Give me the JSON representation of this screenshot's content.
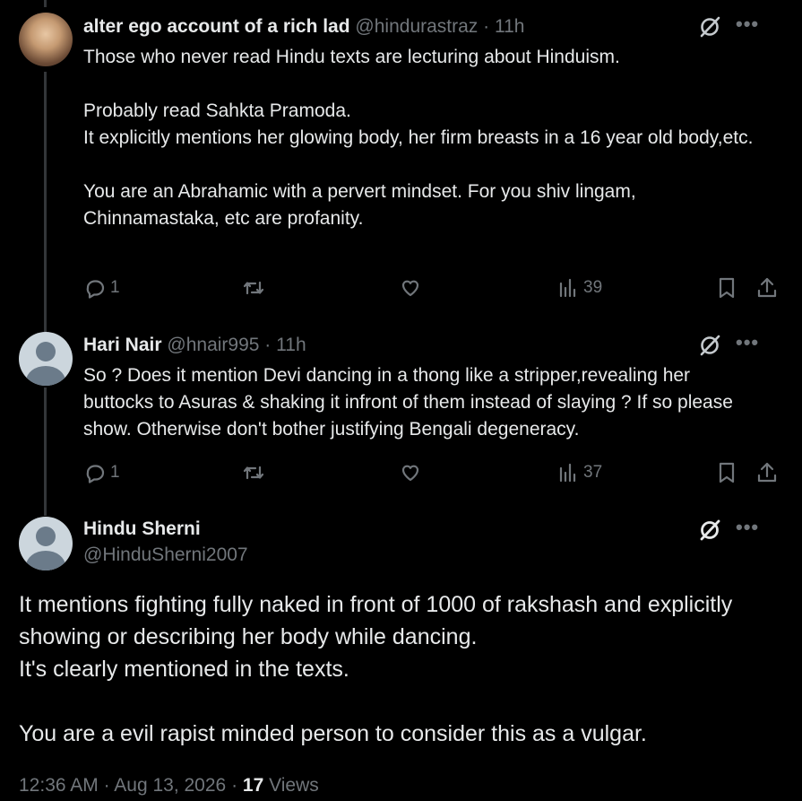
{
  "tweets": [
    {
      "name": "alter ego account of a rich lad",
      "handle": "@hindurastraz",
      "dot": "·",
      "time": "11h",
      "paragraphs": [
        "Those who never read Hindu texts are lecturing about Hinduism.",
        "",
        "Probably read Sahkta Pramoda.",
        "It explicitly mentions her glowing body, her firm breasts in a 16 year old body,etc.",
        "",
        "You are an Abrahamic with a pervert mindset. For you shiv lingam, Chinnamastaka, etc are profanity."
      ],
      "replies": "1",
      "views": "39"
    },
    {
      "name": "Hari Nair",
      "handle": "@hnair995",
      "dot": "·",
      "time": "11h",
      "paragraphs": [
        "So ? Does it mention Devi dancing in a thong like a stripper,revealing her buttocks to Asuras & shaking it infront of them instead of slaying ? If so please show. Otherwise don't bother justifying Bengali degeneracy."
      ],
      "replies": "1",
      "views": "37"
    }
  ],
  "main_tweet": {
    "name": "Hindu Sherni",
    "handle": "@HinduSherni2007",
    "paragraphs": [
      "It mentions fighting fully naked in front of 1000 of rakshash and explicitly showing or describing her body while dancing.",
      "It's clearly mentioned in the texts.",
      "",
      "You are a evil rapist minded person to consider this as a vulgar."
    ],
    "time": "12:36 AM",
    "sep1": "·",
    "date": "Aug 13, 2026",
    "sep2": "·",
    "views_count": "17",
    "views_label": "Views"
  },
  "icons": {
    "reply": "reply-icon",
    "retweet": "retweet-icon",
    "like": "heart-icon",
    "views": "views-icon",
    "bookmark": "bookmark-icon",
    "share": "share-icon",
    "grok": "grok-icon",
    "more": "more-icon"
  },
  "colors": {
    "background": "#000000",
    "text": "#e7e9ea",
    "muted": "#71767b",
    "thread_line": "#333639"
  }
}
